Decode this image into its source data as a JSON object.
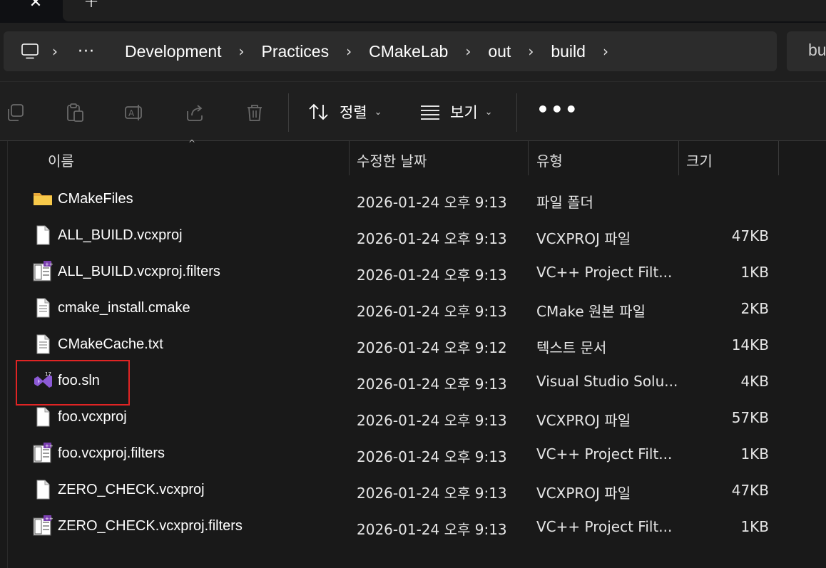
{
  "tabs": {
    "close_icon": "close-icon",
    "new_tab_icon": "plus-icon"
  },
  "address": {
    "root_icon": "computer-icon",
    "overflow": "···",
    "crumbs": [
      "Development",
      "Practices",
      "CMakeLab",
      "out",
      "build"
    ],
    "search_partial": "bu"
  },
  "toolbar": {
    "icons": [
      "copy-icon",
      "paste-icon",
      "rename-icon",
      "share-icon",
      "delete-icon"
    ],
    "sort_label": "정렬",
    "view_label": "보기",
    "more": "•••"
  },
  "columns": {
    "name": "이름",
    "date": "수정한 날짜",
    "type": "유형",
    "size": "크기"
  },
  "files": [
    {
      "name": "CMakeFiles",
      "date": "2026-01-24 오후 9:13",
      "type": "파일 폴더",
      "size": "",
      "icon": "folder-icon"
    },
    {
      "name": "ALL_BUILD.vcxproj",
      "date": "2026-01-24 오후 9:13",
      "type": "VCXPROJ 파일",
      "size": "47KB",
      "icon": "file-icon"
    },
    {
      "name": "ALL_BUILD.vcxproj.filters",
      "date": "2026-01-24 오후 9:13",
      "type": "VC++ Project Filt...",
      "size": "1KB",
      "icon": "filters-file-icon"
    },
    {
      "name": "cmake_install.cmake",
      "date": "2026-01-24 오후 9:13",
      "type": "CMake 원본 파일",
      "size": "2KB",
      "icon": "text-file-icon"
    },
    {
      "name": "CMakeCache.txt",
      "date": "2026-01-24 오후 9:12",
      "type": "텍스트 문서",
      "size": "14KB",
      "icon": "text-file-icon"
    },
    {
      "name": "foo.sln",
      "date": "2026-01-24 오후 9:13",
      "type": "Visual Studio Solu...",
      "size": "4KB",
      "icon": "visual-studio-solution-icon"
    },
    {
      "name": "foo.vcxproj",
      "date": "2026-01-24 오후 9:13",
      "type": "VCXPROJ 파일",
      "size": "57KB",
      "icon": "file-icon"
    },
    {
      "name": "foo.vcxproj.filters",
      "date": "2026-01-24 오후 9:13",
      "type": "VC++ Project Filt...",
      "size": "1KB",
      "icon": "filters-file-icon"
    },
    {
      "name": "ZERO_CHECK.vcxproj",
      "date": "2026-01-24 오후 9:13",
      "type": "VCXPROJ 파일",
      "size": "47KB",
      "icon": "file-icon"
    },
    {
      "name": "ZERO_CHECK.vcxproj.filters",
      "date": "2026-01-24 오후 9:13",
      "type": "VC++ Project Filt...",
      "size": "1KB",
      "icon": "filters-file-icon"
    }
  ],
  "highlight_color": "#e02424",
  "vs_badge": "17"
}
